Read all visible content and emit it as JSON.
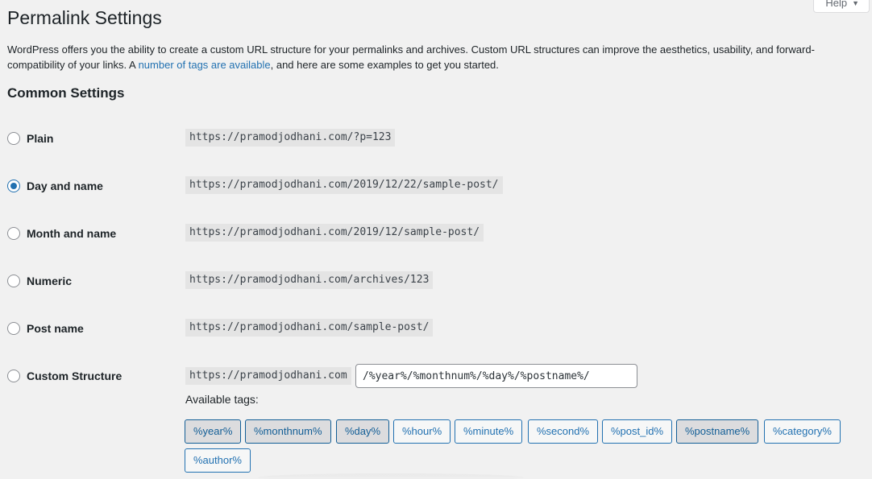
{
  "help": {
    "label": "Help",
    "caret": "▼"
  },
  "page_title": "Permalink Settings",
  "intro": {
    "before_link": "WordPress offers you the ability to create a custom URL structure for your permalinks and archives. Custom URL structures can improve the aesthetics, usability, and forward-compatibility of your links. A ",
    "link_text": "number of tags are available",
    "after_link": ", and here are some examples to get you started."
  },
  "section_title": "Common Settings",
  "options": [
    {
      "label": "Plain",
      "example": "https://pramodjodhani.com/?p=123",
      "checked": false
    },
    {
      "label": "Day and name",
      "example": "https://pramodjodhani.com/2019/12/22/sample-post/",
      "checked": true
    },
    {
      "label": "Month and name",
      "example": "https://pramodjodhani.com/2019/12/sample-post/",
      "checked": false
    },
    {
      "label": "Numeric",
      "example": "https://pramodjodhani.com/archives/123",
      "checked": false
    },
    {
      "label": "Post name",
      "example": "https://pramodjodhani.com/sample-post/",
      "checked": false
    },
    {
      "label": "Custom Structure",
      "example": "https://pramodjodhani.com",
      "checked": false
    }
  ],
  "custom_structure_value": "/%year%/%monthnum%/%day%/%postname%/",
  "available_tags_label": "Available tags:",
  "tags": [
    {
      "label": "%year%",
      "active": true
    },
    {
      "label": "%monthnum%",
      "active": true
    },
    {
      "label": "%day%",
      "active": true
    },
    {
      "label": "%hour%",
      "active": false
    },
    {
      "label": "%minute%",
      "active": false
    },
    {
      "label": "%second%",
      "active": false
    },
    {
      "label": "%post_id%",
      "active": false
    },
    {
      "label": "%postname%",
      "active": true
    },
    {
      "label": "%category%",
      "active": false
    },
    {
      "label": "%author%",
      "active": false
    }
  ],
  "colors": {
    "accent": "#2271b1",
    "background": "#f1f1f1",
    "code_background": "#e4e4e4"
  }
}
